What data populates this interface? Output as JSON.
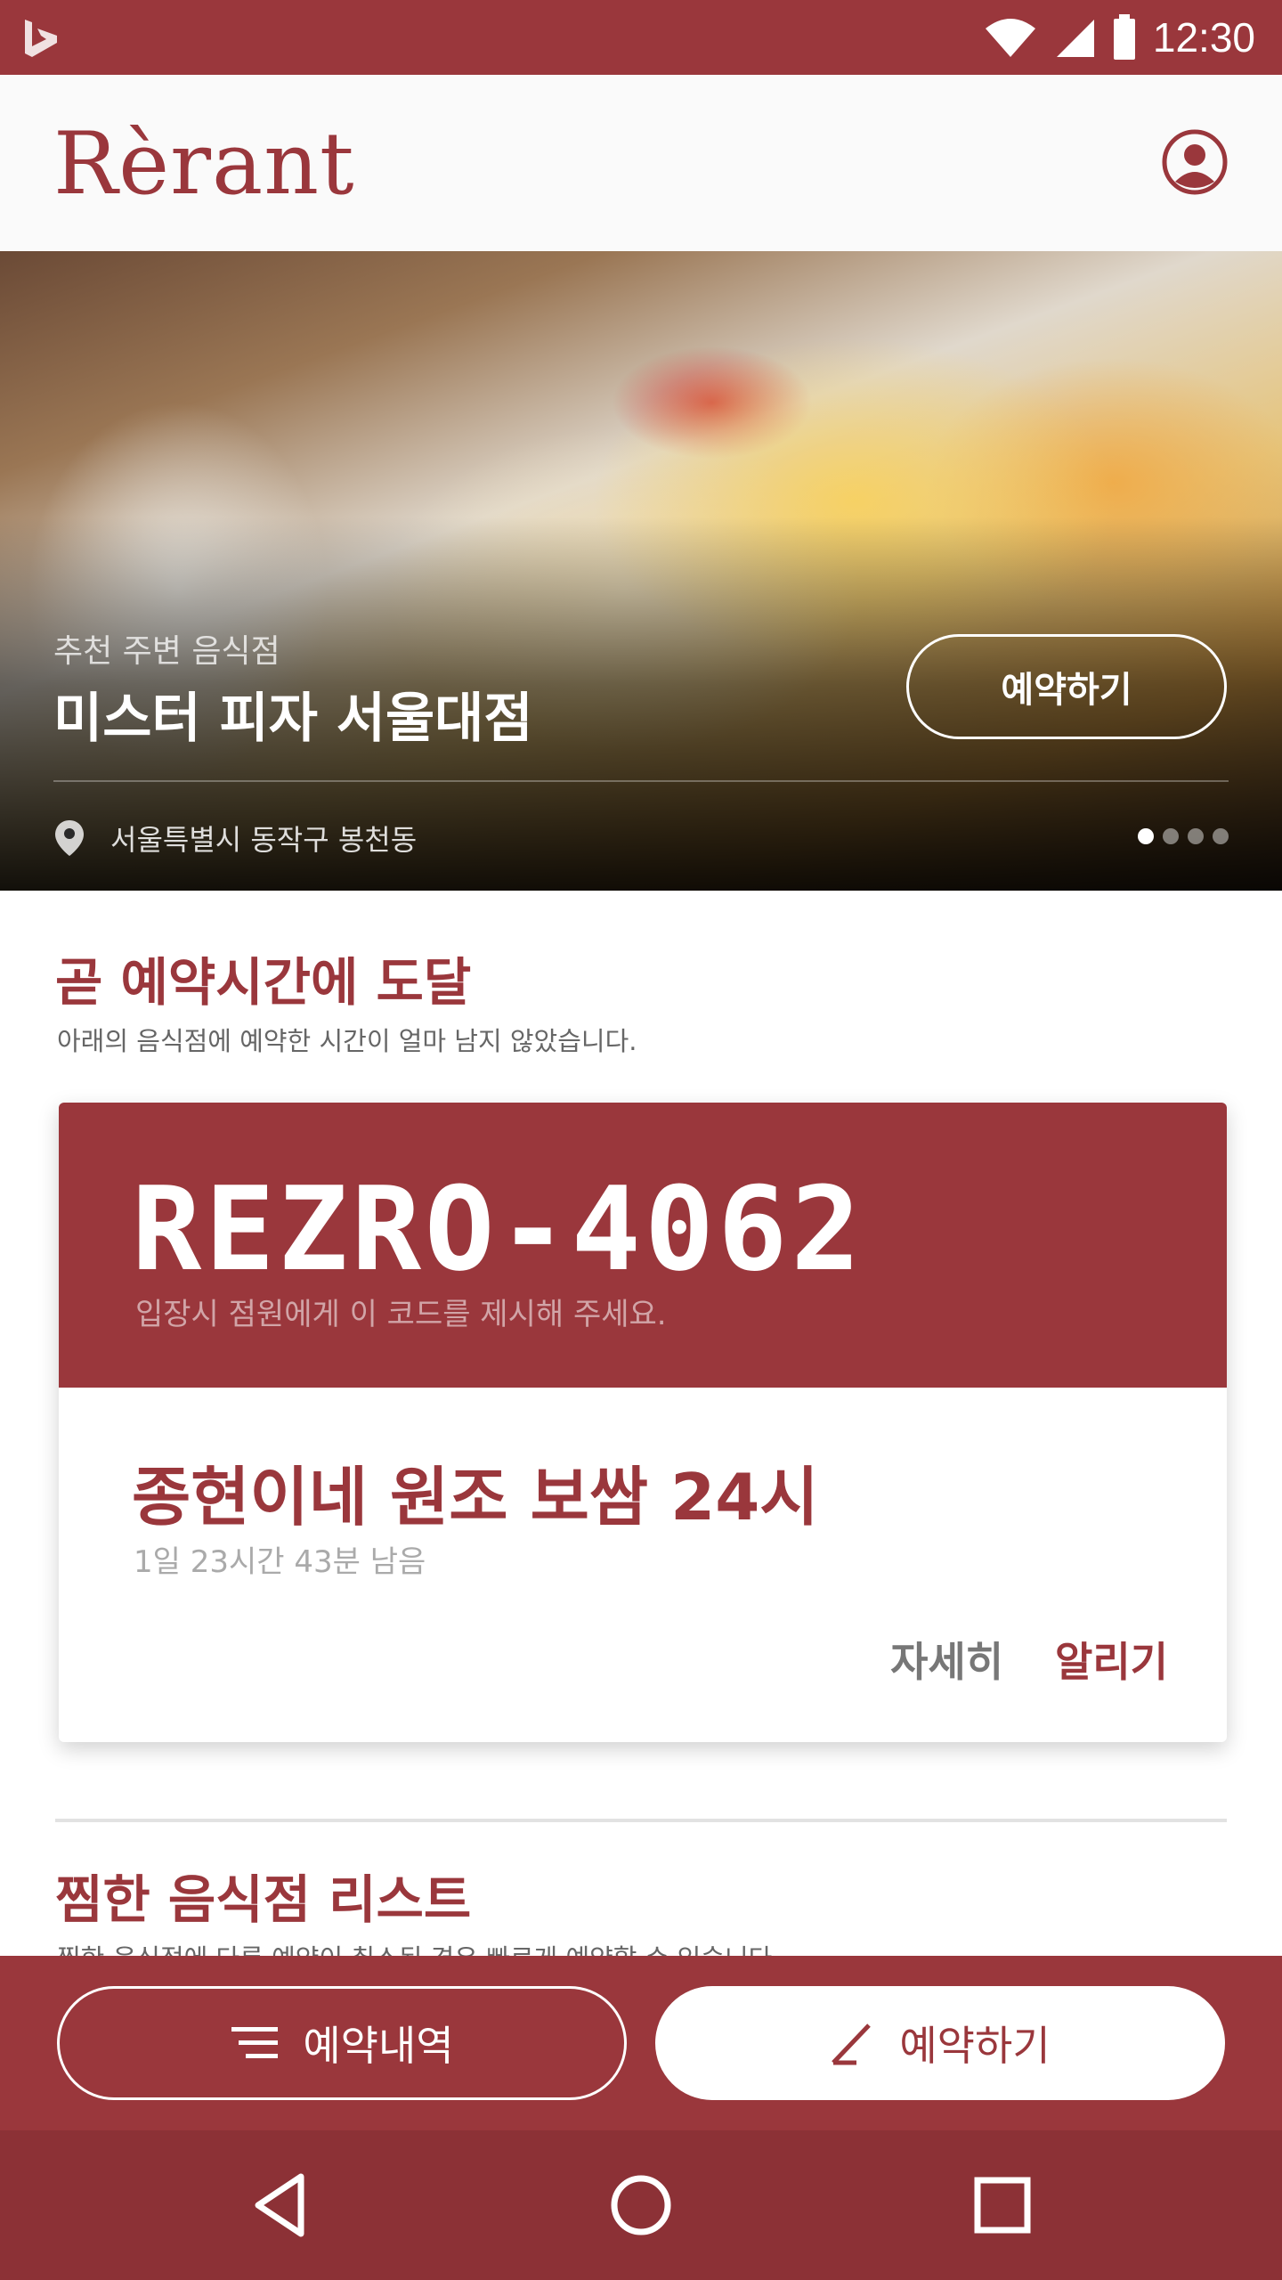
{
  "status_bar": {
    "time": "12:30"
  },
  "app": {
    "logo": "Rèrant"
  },
  "hero": {
    "subtitle": "추천 주변 음식점",
    "title": "미스터 피자 서울대점",
    "reserve_label": "예약하기",
    "address": "서울특별시 동작구 봉천동",
    "pages_total": 4,
    "page_active": 1
  },
  "upcoming": {
    "title": "곧 예약시간에 도달",
    "description": "아래의 음식점에 예약한 시간이 얼마 남지 않았습니다.",
    "code": "REZRO-4062",
    "code_hint": "입장시 점원에게 이 코드를 제시해 주세요.",
    "restaurant": "종현이네 원조 보쌈 24시",
    "remaining": "1일 23시간 43분 남음",
    "detail_label": "자세히",
    "notify_label": "알리기"
  },
  "favorites": {
    "title": "찜한 음식점 리스트",
    "description": "찜한 음식점에 다른 예약이 취소된 경우 빠르게 예약할 수 있습니다."
  },
  "bottom": {
    "history_label": "예약내역",
    "reserve_label": "예약하기"
  },
  "colors": {
    "brand": "#9a373c",
    "nav": "#8c3136"
  }
}
